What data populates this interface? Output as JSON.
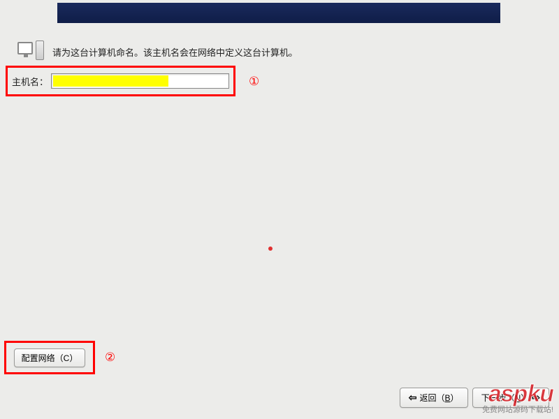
{
  "header": {},
  "description": "请为这台计算机命名。该主机名会在网络中定义这台计算机。",
  "hostname": {
    "label": "主机名：",
    "value": ""
  },
  "annotations": {
    "one": "①",
    "two": "②"
  },
  "buttons": {
    "configure_network": "配置网络（C）",
    "back_prefix": "返回（",
    "back_key": "B",
    "back_suffix": "）",
    "next_prefix": "下一步（",
    "next_key": "N",
    "next_suffix": "）"
  },
  "arrows": {
    "left": "⇦",
    "right": "⇨"
  },
  "watermark": {
    "logo": "aspku",
    "sub": "免费网站源码下载站!"
  }
}
